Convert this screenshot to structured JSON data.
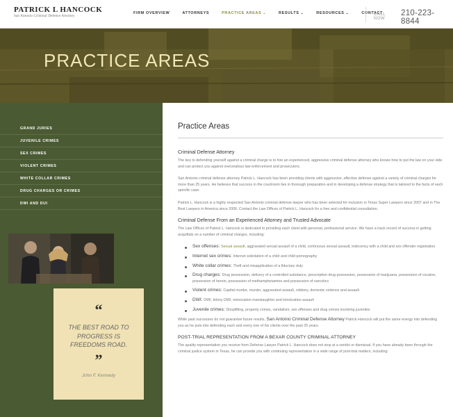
{
  "header": {
    "logo_name": "PATRICK L HANCOCK",
    "logo_sub": "San Antonio Criminal Defense Attorney",
    "nav": [
      {
        "label": "FIRM OVERVIEW",
        "dropdown": false,
        "active": false
      },
      {
        "label": "ATTORNEYS",
        "dropdown": false,
        "active": false
      },
      {
        "label": "PRACTICE AREAS",
        "dropdown": true,
        "active": true
      },
      {
        "label": "RESULTS",
        "dropdown": true,
        "active": false
      },
      {
        "label": "RESOURCES",
        "dropdown": true,
        "active": false
      },
      {
        "label": "CONTACT",
        "dropdown": false,
        "active": false
      }
    ],
    "call_label": "CALL NOW",
    "phone": "210-223-8844"
  },
  "hero": {
    "title": "PRACTICE AREAS"
  },
  "sidebar": {
    "items": [
      "GRAND JURIES",
      "JUVENILE CRIMES",
      "SEX CRIMES",
      "VIOLENT CRIMES",
      "WHITE COLLAR CRIMES",
      "DRUG CHARGES OR CRIMES",
      "DWI AND DUI"
    ],
    "quote_open": "“",
    "quote_text": "THE BEST ROAD TO PROGRESS IS FREEDOMS ROAD.",
    "quote_close": "”",
    "quote_author": "John F. Kennedy"
  },
  "main": {
    "heading": "Practice Areas",
    "section1_title": "Criminal Defense Attorney",
    "p1": "The key to defending yourself against a criminal charge is to hire an experienced, aggressive criminal defense attorney who knows how to put the law on your side and can protect you against overzealous law enforcement and prosecutors.",
    "p2": "San Antonio criminal defense attorney Patrick L. Hancock has been providing clients with aggressive, effective defense against a variety of criminal charges for more than 25 years. He believes that success in the courtroom lies in thorough preparation and in developing a defense strategy that is tailored to the facts of each specific case.",
    "p3": "Patrick L. Hancock is a highly respected San Antonio criminal defense lawyer who has been selected for inclusion in Texas Super Lawyers since 2007 and in The Best Lawyers in America since 2006. Contact the Law Offices of Patrick L. Hancock for a free and confidential consultation.",
    "section2_title": "Criminal Defense From an Experienced Attorney and Trusted Advocate",
    "p4": "The Law Offices of Patrick L. Hancock is dedicated to providing each client with personal, professional service. We have a track record of success in getting acquittals on a number of criminal charges, including:",
    "bullets": [
      {
        "term": "Sex offenses: ",
        "link": "Sexual assault",
        "rest": ", aggravated sexual assault of a child, continuous sexual assault, indecency with a child and sex offender registration"
      },
      {
        "term": "Internet sex crimes: ",
        "link": "",
        "rest": "Internet solicitation of a child and child pornography"
      },
      {
        "term": "White collar crimes: ",
        "link": "",
        "rest": "Theft and misapplication of a fiduciary duty"
      },
      {
        "term": "Drug charges: ",
        "link": "",
        "rest": "Drug possession, delivery of a controlled substance, prescription drug possession, possession of marijuana, possession of cocaine, possession of heroin, possession of methamphetamine and possession of narcotics"
      },
      {
        "term": "Violent crimes: ",
        "link": "",
        "rest": "Capital murder, murder, aggravated assault, robbery, domestic violence and assault"
      },
      {
        "term": "DWI: ",
        "link": "",
        "rest": "DWI, felony DWI, intoxication manslaughter and intoxication assault"
      },
      {
        "term": "Juvenile crimes: ",
        "link": "",
        "rest": "Shoplifting, property crimes, vandalism, sex offenses and drug crimes involving juveniles"
      }
    ],
    "p5_pre": "While past successes do not guarantee future results, ",
    "p5_big": "San Antonio Criminal Defense Attorney",
    "p5_post": " Patrick Hancock will put the same energy into defending you as he puts into defending each and every one of his clients over the past 25 years.",
    "section3_title": "POST-TRIAL REPRESENTATION FROM A BEXAR COUNTY CRIMINAL ATTORNEY",
    "p6": "The quality representation you receive from Defense Lawyer Patrick L. Hancock does not stop at a verdict or dismissal. If you have already been through the criminal justice system in Texas, he can provide you with continuing representation in a wide range of post-trial matters, including:"
  }
}
